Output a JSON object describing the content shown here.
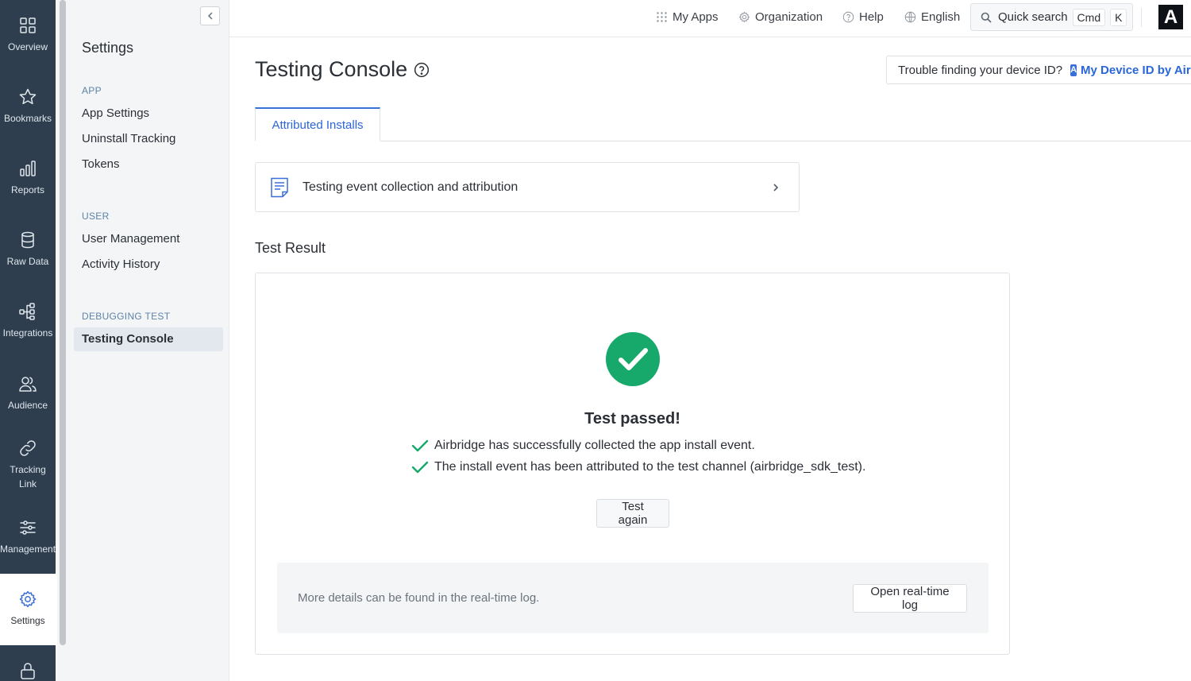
{
  "rail": {
    "items": [
      {
        "label": "Overview",
        "icon": "overview-icon"
      },
      {
        "label": "Bookmarks",
        "icon": "star-icon"
      },
      {
        "label": "Reports",
        "icon": "bar-chart-icon"
      },
      {
        "label": "Raw Data",
        "icon": "database-icon"
      },
      {
        "label": "Integrations",
        "icon": "integrations-icon"
      },
      {
        "label": "Audience",
        "icon": "users-icon"
      },
      {
        "label": "Tracking\nLink",
        "icon": "link-icon"
      },
      {
        "label": "Management",
        "icon": "sliders-icon"
      },
      {
        "label": "Settings",
        "icon": "gear-icon",
        "active": true
      },
      {
        "label": "",
        "icon": "lock-icon"
      }
    ]
  },
  "sidebar": {
    "title": "Settings",
    "sections": [
      {
        "label": "APP",
        "items": [
          "App Settings",
          "Uninstall Tracking",
          "Tokens"
        ]
      },
      {
        "label": "USER",
        "items": [
          "User Management",
          "Activity History"
        ]
      },
      {
        "label": "DEBUGGING TEST",
        "items": [
          "Testing Console"
        ]
      }
    ],
    "active_item": "Testing Console"
  },
  "topbar": {
    "my_apps": "My Apps",
    "organization": "Organization",
    "help": "Help",
    "language": "English",
    "quick_search": "Quick search",
    "shortcut_key1": "Cmd",
    "shortcut_key2": "K",
    "brand_letter": "A"
  },
  "main": {
    "title": "Testing Console",
    "device_help_text": "Trouble finding your device ID?",
    "device_help_logo": "A",
    "device_help_link": "My Device ID by Airbridge",
    "tabs": [
      {
        "label": "Attributed Installs",
        "active": true
      }
    ],
    "guide_card_text": "Testing event collection and attribution",
    "section_title": "Test Result",
    "result": {
      "headline": "Test passed!",
      "checks": [
        "Airbridge has successfully collected the app install event.",
        "The install event has been attributed to the test channel (airbridge_sdk_test)."
      ],
      "test_again_label": "Test again",
      "log_text": "More details can be found in the real-time log.",
      "open_log_label": "Open real-time log"
    }
  },
  "colors": {
    "rail_bg": "#2e3e4e",
    "accent": "#3a6fd8",
    "link": "#2a66d9",
    "success": "#17a86b",
    "sidebar_bg": "#f3f5f7"
  }
}
